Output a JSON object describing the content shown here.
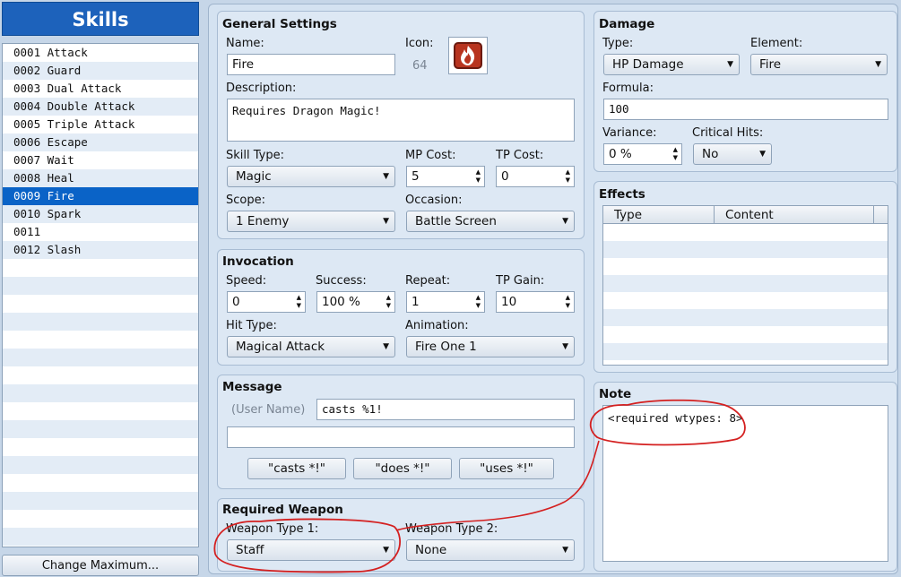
{
  "sidebar": {
    "title": "Skills",
    "items": [
      {
        "label": "0001 Attack"
      },
      {
        "label": "0002 Guard"
      },
      {
        "label": "0003 Dual Attack"
      },
      {
        "label": "0004 Double Attack"
      },
      {
        "label": "0005 Triple Attack"
      },
      {
        "label": "0006 Escape"
      },
      {
        "label": "0007 Wait"
      },
      {
        "label": "0008 Heal"
      },
      {
        "label": "0009 Fire"
      },
      {
        "label": "0010 Spark"
      },
      {
        "label": "0011"
      },
      {
        "label": "0012 Slash"
      }
    ],
    "selected_index": 8,
    "change_max_label": "Change Maximum..."
  },
  "general": {
    "title": "General Settings",
    "name_label": "Name:",
    "name_value": "Fire",
    "icon_label": "Icon:",
    "icon_index": "64",
    "icon_name": "fire-icon",
    "description_label": "Description:",
    "description_value": "Requires Dragon Magic!",
    "skill_type_label": "Skill Type:",
    "skill_type_value": "Magic",
    "mp_cost_label": "MP Cost:",
    "mp_cost_value": "5",
    "tp_cost_label": "TP Cost:",
    "tp_cost_value": "0",
    "scope_label": "Scope:",
    "scope_value": "1 Enemy",
    "occasion_label": "Occasion:",
    "occasion_value": "Battle Screen"
  },
  "invocation": {
    "title": "Invocation",
    "speed_label": "Speed:",
    "speed_value": "0",
    "success_label": "Success:",
    "success_value": "100 %",
    "repeat_label": "Repeat:",
    "repeat_value": "1",
    "tp_gain_label": "TP Gain:",
    "tp_gain_value": "10",
    "hit_type_label": "Hit Type:",
    "hit_type_value": "Magical Attack",
    "animation_label": "Animation:",
    "animation_value": "Fire One 1"
  },
  "message": {
    "title": "Message",
    "user_name_label": "(User Name)",
    "line1_value": "casts %1!",
    "line2_value": "",
    "buttons": [
      "\"casts *!\"",
      "\"does *!\"",
      "\"uses *!\""
    ]
  },
  "required_weapon": {
    "title": "Required Weapon",
    "type1_label": "Weapon Type 1:",
    "type1_value": "Staff",
    "type2_label": "Weapon Type 2:",
    "type2_value": "None"
  },
  "damage": {
    "title": "Damage",
    "type_label": "Type:",
    "type_value": "HP Damage",
    "element_label": "Element:",
    "element_value": "Fire",
    "formula_label": "Formula:",
    "formula_value": "100",
    "variance_label": "Variance:",
    "variance_value": "0 %",
    "critical_label": "Critical Hits:",
    "critical_value": "No"
  },
  "effects": {
    "title": "Effects",
    "columns": [
      "Type",
      "Content"
    ]
  },
  "note": {
    "title": "Note",
    "value": "<required wtypes: 8>"
  },
  "annotation_color": "#d42020"
}
